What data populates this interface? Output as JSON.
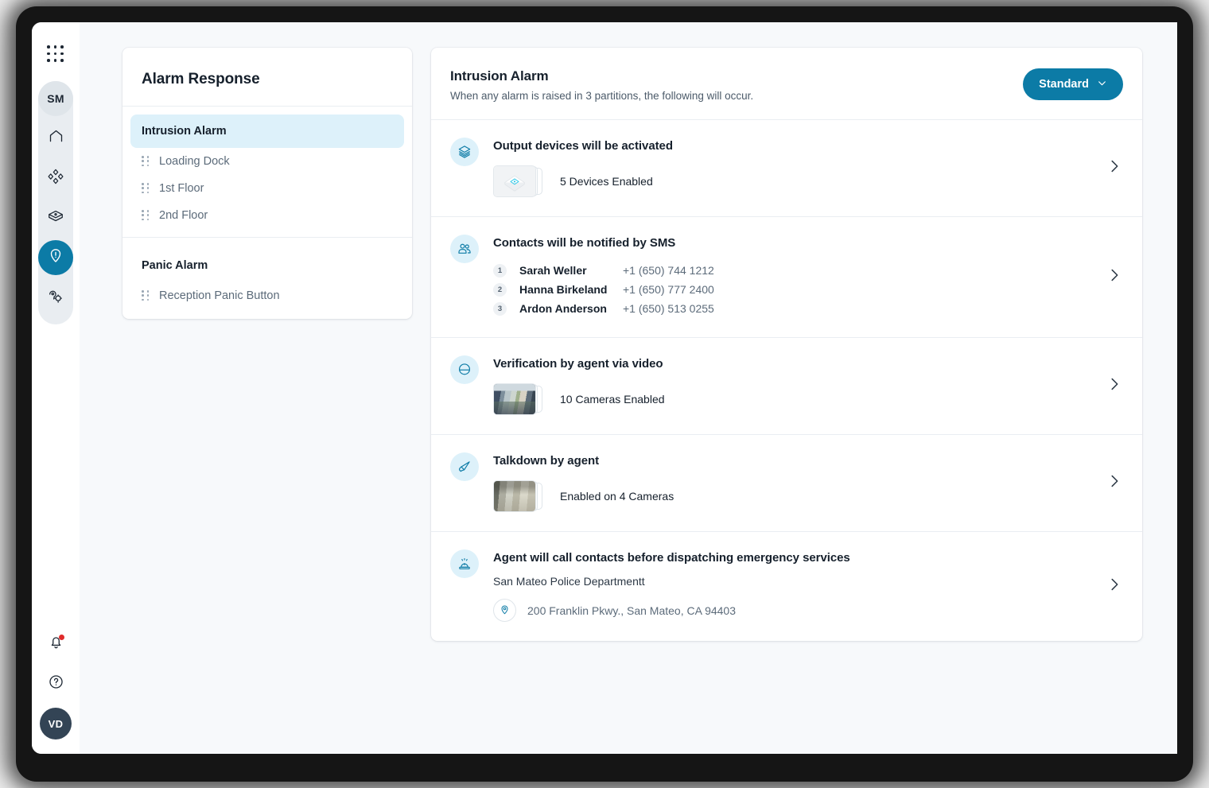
{
  "sidebar": {
    "apps_grid_icon": "grid-dots-icon",
    "org_badge": "SM",
    "nav": [
      {
        "icon": "home-icon",
        "name": "home",
        "active": false
      },
      {
        "icon": "diamonds-icon",
        "name": "sites",
        "active": false
      },
      {
        "icon": "box-icon",
        "name": "devices",
        "active": false
      },
      {
        "icon": "alarm-shield-icon",
        "name": "alarms",
        "active": true
      },
      {
        "icon": "settings-tag-icon",
        "name": "settings",
        "active": false
      }
    ],
    "bottom": [
      {
        "icon": "bell-icon",
        "name": "notifications",
        "has_dot": true
      },
      {
        "icon": "help-circle-icon",
        "name": "help"
      }
    ],
    "user_initials": "VD"
  },
  "alarm_list": {
    "title": "Alarm Response",
    "groups": [
      {
        "label": "Intrusion Alarm",
        "selected": true,
        "partitions": [
          {
            "label": "Loading Dock"
          },
          {
            "label": "1st Floor"
          },
          {
            "label": "2nd Floor"
          }
        ]
      },
      {
        "label": "Panic Alarm",
        "selected": false,
        "partitions": [
          {
            "label": "Reception Panic Button"
          }
        ]
      }
    ]
  },
  "detail": {
    "title": "Intrusion Alarm",
    "subtitle": "When any alarm is raised in 3 partitions, the following will occur.",
    "mode_button": {
      "label": "Standard",
      "chevron_icon": "chevron-down-icon",
      "color": "#0c7ba6"
    },
    "actions": [
      {
        "id": "output-devices",
        "icon": "layers-stack-icon",
        "title": "Output devices will be activated",
        "thumb_kind": "device",
        "thumb_label": "5 Devices Enabled",
        "chevron_icon": "chevron-right-icon"
      },
      {
        "id": "sms-contacts",
        "icon": "contacts-people-icon",
        "title": "Contacts will be notified by SMS",
        "contacts": [
          {
            "index": "1",
            "name": "Sarah Weller",
            "phone": "+1 (650) 744 1212"
          },
          {
            "index": "2",
            "name": "Hanna Birkeland",
            "phone": "+1 (650) 777 2400"
          },
          {
            "index": "3",
            "name": "Ardon Anderson",
            "phone": "+1 (650) 513 0255"
          }
        ],
        "chevron_icon": "chevron-right-icon"
      },
      {
        "id": "video-verification",
        "icon": "dome-camera-icon",
        "title": "Verification by agent via video",
        "thumb_kind": "street",
        "thumb_label": "10 Cameras Enabled",
        "chevron_icon": "chevron-right-icon"
      },
      {
        "id": "talkdown",
        "icon": "megaphone-icon",
        "title": "Talkdown by agent",
        "thumb_kind": "hall",
        "thumb_label": "Enabled on 4 Cameras",
        "chevron_icon": "chevron-right-icon"
      },
      {
        "id": "emergency-dispatch",
        "icon": "siren-icon",
        "title": "Agent will call contacts before dispatching emergency services",
        "dispatch_name": "San Mateo Police Departmentt",
        "address_pin_icon": "map-pin-icon",
        "address": "200 Franklin Pkwy., San Mateo, CA 94403",
        "chevron_icon": "chevron-right-icon"
      }
    ]
  },
  "colors": {
    "accent": "#0c7ba6",
    "accent_soft": "#ddf1fa",
    "page_bg": "#f7f9fb",
    "text_dark": "#16202c",
    "text_muted": "#5c6b7a",
    "alert_dot": "#e02b2b"
  }
}
